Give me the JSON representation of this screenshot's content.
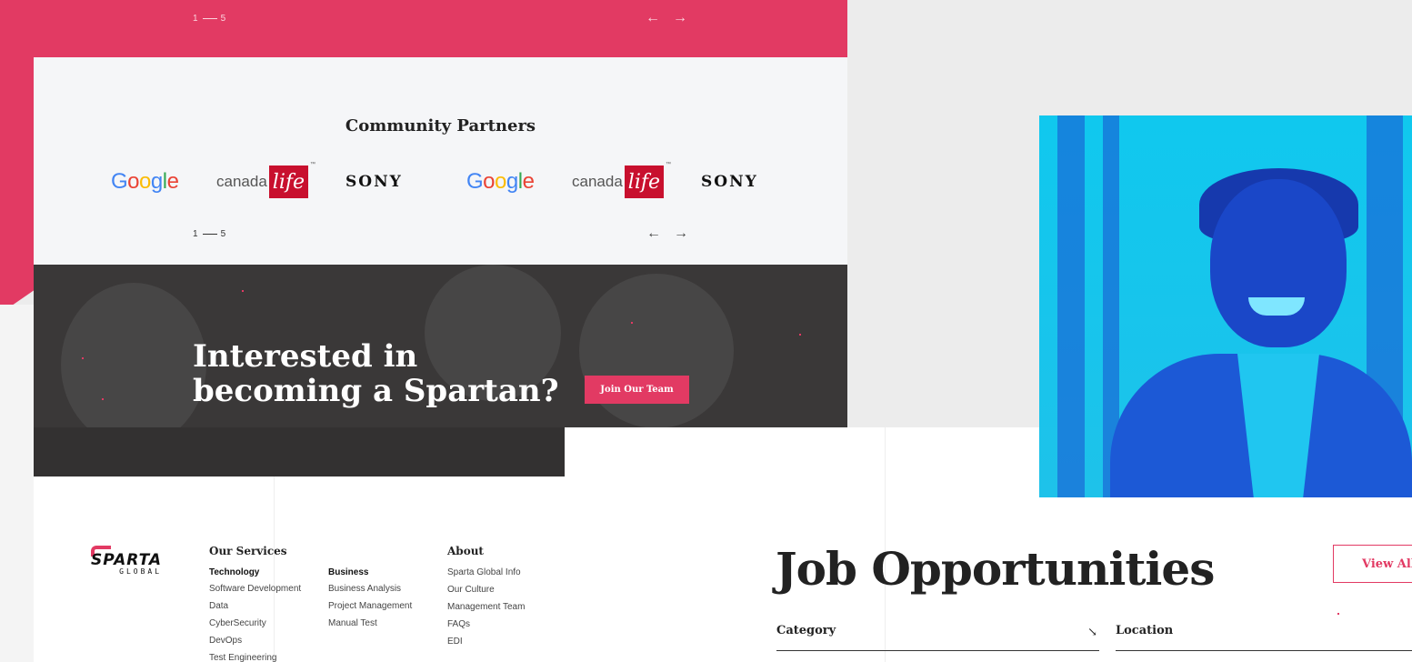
{
  "top_slider": {
    "counter_start": "1",
    "counter_end": "5",
    "prev": "←",
    "next": "→"
  },
  "partners": {
    "title": "Community Partners",
    "counter_start": "1",
    "counter_end": "5",
    "prev": "←",
    "next": "→",
    "logos": [
      {
        "name": "Google"
      },
      {
        "name": "canada",
        "badge": "life",
        "tm": "™"
      },
      {
        "name": "SONY"
      },
      {
        "name": "Google"
      },
      {
        "name": "canada",
        "badge": "life",
        "tm": "™"
      },
      {
        "name": "SONY"
      }
    ]
  },
  "cta": {
    "title_line1": "Interested in",
    "title_line2": "becoming a Spartan?",
    "button": "Join Our Team"
  },
  "brand": {
    "name": "SPARTA",
    "sub": "GLOBAL"
  },
  "footer": {
    "services_heading": "Our Services",
    "about_heading": "About",
    "technology": {
      "heading": "Technology",
      "links": [
        "Software Development",
        "Data",
        "CyberSecurity",
        "DevOps",
        "Test Engineering"
      ]
    },
    "business": {
      "heading": "Business",
      "links": [
        "Business Analysis",
        "Project Management",
        "Manual Test"
      ]
    },
    "about": {
      "links": [
        "Sparta Global Info",
        "Our Culture",
        "Management Team",
        "FAQs",
        "EDI"
      ]
    }
  },
  "jobs": {
    "title": "Job Opportunities",
    "view_all": "View All",
    "category_label": "Category",
    "category_arrow": "↘",
    "location_label": "Location"
  },
  "colors": {
    "accent": "#e23a63",
    "dark": "#3a3838",
    "photo_cyan": "#10c8ee",
    "photo_blue": "#1a47c8"
  }
}
